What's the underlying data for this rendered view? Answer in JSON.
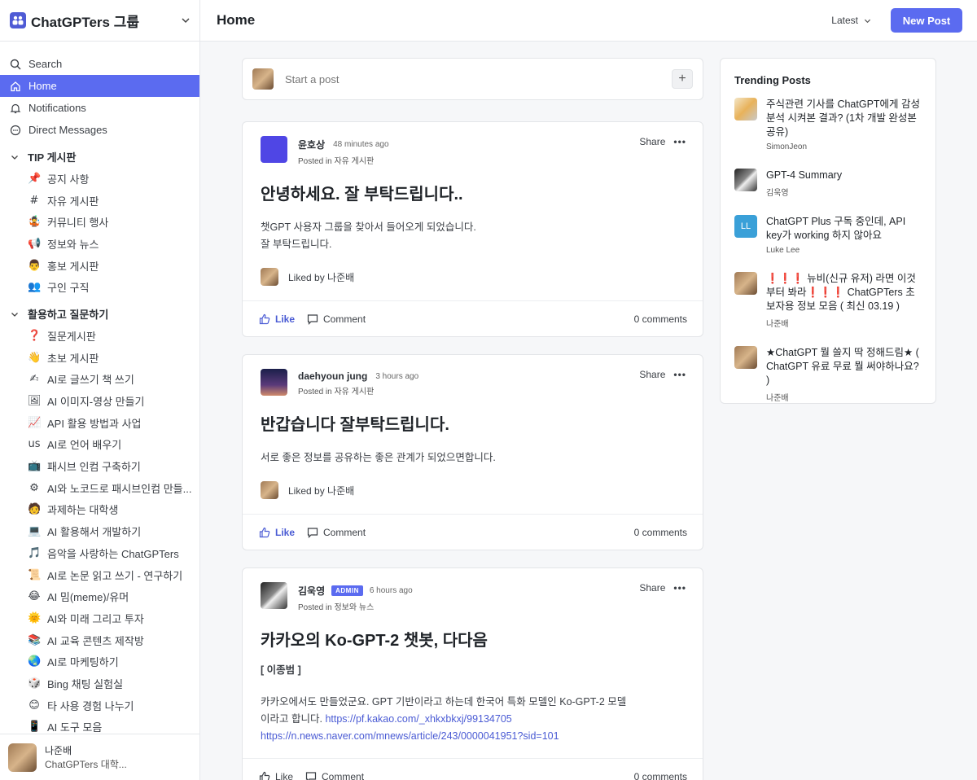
{
  "sidebar": {
    "group_name": "ChatGPTers 그룹",
    "nav": [
      {
        "label": "Search",
        "icon": "search-icon"
      },
      {
        "label": "Home",
        "icon": "home-icon"
      },
      {
        "label": "Notifications",
        "icon": "bell-icon"
      },
      {
        "label": "Direct Messages",
        "icon": "chat-bubble-icon"
      }
    ],
    "sections": [
      {
        "title": "TIP 게시판",
        "items": [
          {
            "emoji": "📌",
            "label": "공지 사항"
          },
          {
            "emoji": "#",
            "label": "자유 게시판"
          },
          {
            "emoji": "🤹",
            "label": "커뮤니티 행사"
          },
          {
            "emoji": "📢",
            "label": "정보와 뉴스"
          },
          {
            "emoji": "👨",
            "label": "홍보 게시판"
          },
          {
            "emoji": "👥",
            "label": "구인 구직"
          }
        ]
      },
      {
        "title": "활용하고 질문하기",
        "items": [
          {
            "emoji": "❓",
            "label": "질문게시판"
          },
          {
            "emoji": "👋",
            "label": "초보 게시판"
          },
          {
            "emoji": "✍",
            "label": "AI로 글쓰기 책 쓰기"
          },
          {
            "emoji": "🖼",
            "label": "AI 이미지-영상 만들기"
          },
          {
            "emoji": "📈",
            "label": "API 활용 방법과 사업"
          },
          {
            "emoji": "us",
            "label": "AI로 언어 배우기"
          },
          {
            "emoji": "📺",
            "label": "패시브 인컴 구축하기"
          },
          {
            "emoji": "⚙",
            "label": "AI와 노코드로 패시브인컴 만들..."
          },
          {
            "emoji": "🧑",
            "label": "과제하는 대학생"
          },
          {
            "emoji": "💻",
            "label": "AI 활용해서 개발하기"
          },
          {
            "emoji": "🎵",
            "label": "음악을 사랑하는 ChatGPTers"
          },
          {
            "emoji": "📜",
            "label": "AI로 논문 읽고 쓰기 - 연구하기"
          },
          {
            "emoji": "😂",
            "label": "AI 밈(meme)/유머"
          },
          {
            "emoji": "🌞",
            "label": "AI와 미래 그리고 투자"
          },
          {
            "emoji": "📚",
            "label": "AI 교육 콘텐츠 제작방"
          },
          {
            "emoji": "🌏",
            "label": "AI로 마케팅하기"
          },
          {
            "emoji": "🎲",
            "label": "Bing 채팅 실험실"
          },
          {
            "emoji": "😊",
            "label": "타 사용 경험 나누기"
          },
          {
            "emoji": "📱",
            "label": "AI 도구 모음"
          }
        ]
      }
    ],
    "user": {
      "name": "나준배",
      "subtitle": "ChatGPTers 대학..."
    }
  },
  "topbar": {
    "title": "Home",
    "sort_label": "Latest",
    "new_post_label": "New Post"
  },
  "composer": {
    "placeholder": "Start a post",
    "plus": "+"
  },
  "posts": [
    {
      "author": "윤호상",
      "time": "48 minutes ago",
      "posted_prefix": "Posted in",
      "channel": "자유 게시판",
      "title": "안녕하세요. 잘 부탁드립니다..",
      "body_lines": [
        "챗GPT 사용자 그룹을 찾아서 들어오게 되었습니다.",
        "잘 부탁드립니다."
      ],
      "liked_by": "Liked by 나준배",
      "share": "Share",
      "like": "Like",
      "comment": "Comment",
      "comments_count": "0 comments"
    },
    {
      "author": "daehyoun jung",
      "time": "3 hours ago",
      "posted_prefix": "Posted in",
      "channel": "자유 게시판",
      "title": "반갑습니다 잘부탁드립니다.",
      "body_lines": [
        "서로 좋은 정보를 공유하는 좋은 관계가 되었으면합니다."
      ],
      "liked_by": "Liked by 나준배",
      "share": "Share",
      "like": "Like",
      "comment": "Comment",
      "comments_count": "0 comments"
    },
    {
      "author": "김욱영",
      "badge": "ADMIN",
      "time": "6 hours ago",
      "posted_prefix": "Posted in",
      "channel": "정보와 뉴스",
      "title": "카카오의 Ko-GPT-2 챗봇, 다다음",
      "subhead": "[ 이종범 ]",
      "body_line1": "카카오에서도 만들었군요. GPT 기반이라고 하는데 한국어 특화 모델인 Ko-GPT-2 모델",
      "body_line2": "이라고 합니다.",
      "link1": "https://pf.kakao.com/_xhkxbkxj/99134705",
      "link2": "https://n.news.naver.com/mnews/article/243/0000041951?sid=101",
      "share": "Share",
      "like": "Like",
      "comment": "Comment",
      "comments_count": "0 comments"
    }
  ],
  "trending": {
    "title": "Trending Posts",
    "items": [
      {
        "text": "주식관련 기사를 ChatGPT에게 감성 분석 시켜본 결과? (1차 개발 완성본 공유)",
        "author": "SimonJeon"
      },
      {
        "text": "GPT-4 Summary",
        "author": "김욱영"
      },
      {
        "text": "ChatGPT Plus 구독 중인데, API key가 working 하지 않아요",
        "author": "Luke Lee",
        "initials": "LL"
      },
      {
        "text": "❗❗❗ 뉴비(신규 유저) 라면 이것부터 봐라❗❗❗ ChatGPTers 초보자용 정보 모음 ( 최신 03.19 )",
        "author": "나준배"
      },
      {
        "text": "★ChatGPT 뭘 쓸지 딱 정해드림★ ( ChatGPT 유료 무료 뭘 써야하나요? )",
        "author": "나준배"
      }
    ]
  },
  "colors": {
    "accent": "#5b6bf0",
    "link": "#4a5bd4"
  }
}
